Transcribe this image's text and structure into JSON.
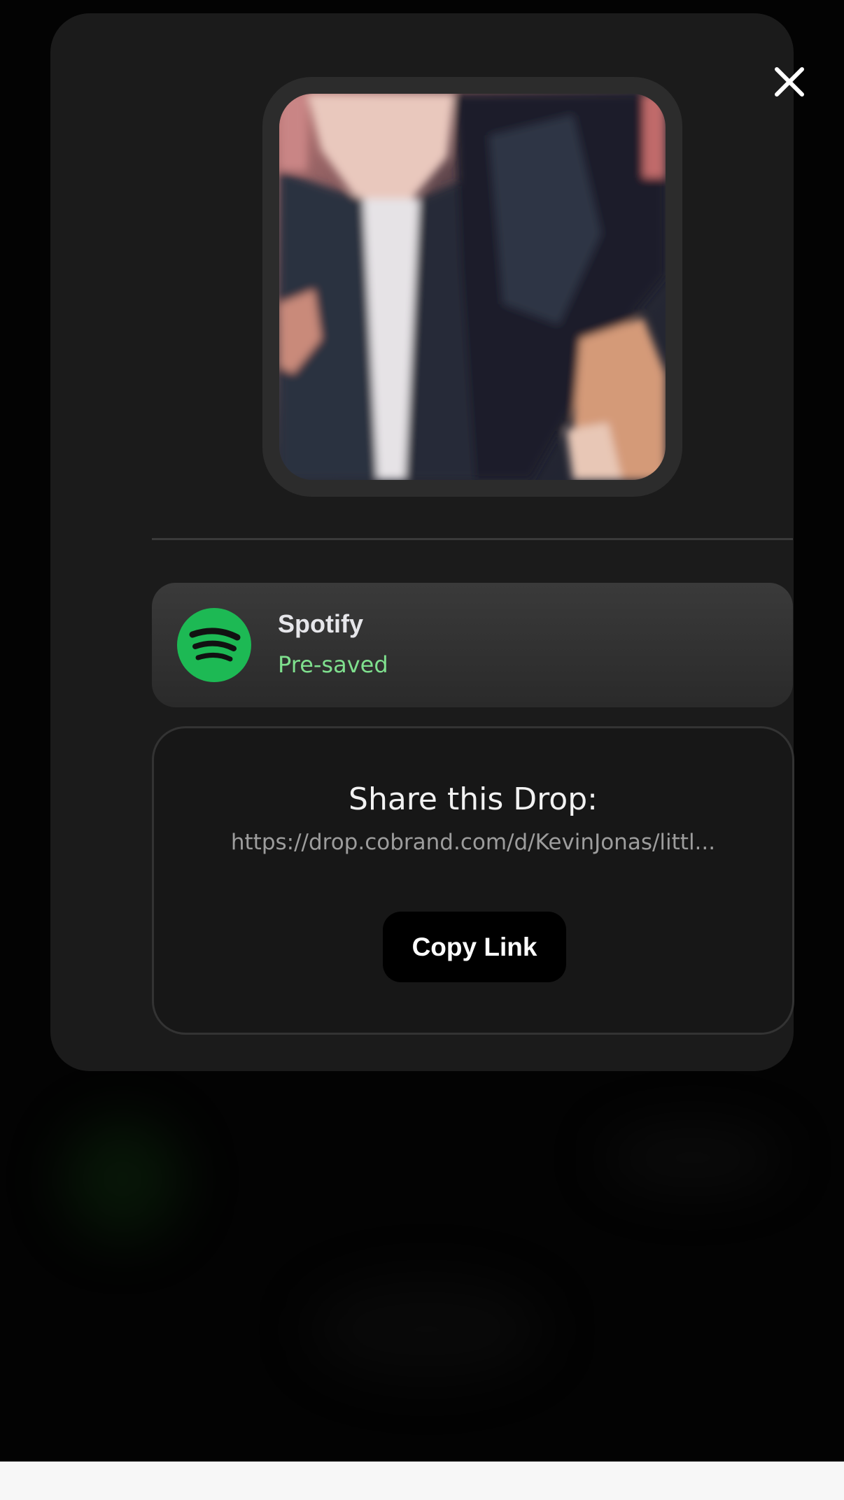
{
  "modal": {
    "close_icon": "close-icon"
  },
  "cover": {
    "description_icon": "album-cover-image"
  },
  "service": {
    "name": "Spotify",
    "status": "Pre-saved",
    "icon": "spotify-logo-icon",
    "brand_color": "#1DB954",
    "status_color": "#7FE08E"
  },
  "share": {
    "title": "Share this Drop:",
    "url": "https://drop.cobrand.com/d/KevinJonas/littl...",
    "copy_label": "Copy Link"
  },
  "colors": {
    "background": "#030303",
    "modal": "#1B1B1B",
    "card": "#333333"
  }
}
